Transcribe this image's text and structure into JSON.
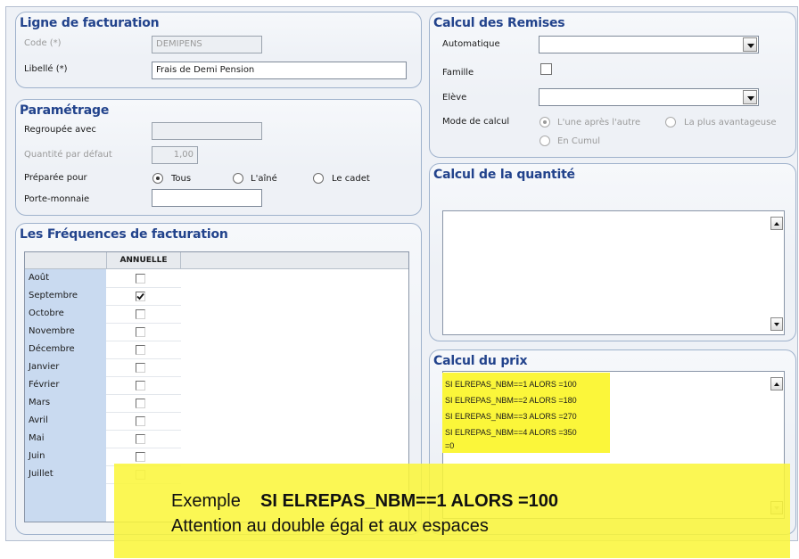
{
  "ligne": {
    "title": "Ligne de facturation",
    "code_label": "Code (*)",
    "code_value": "DEMIPENS",
    "libelle_label": "Libellé (*)",
    "libelle_value": "Frais de Demi Pension"
  },
  "parametrage": {
    "title": "Paramétrage",
    "regroupee_label": "Regroupée avec",
    "regroupee_value": "",
    "quantite_label": "Quantité par défaut",
    "quantite_value": "1,00",
    "preparee_label": "Préparée pour",
    "options": [
      "Tous",
      "L'aîné",
      "Le cadet"
    ],
    "selected_option": "Tous",
    "porte_label": "Porte-monnaie",
    "porte_value": ""
  },
  "frequences": {
    "title": "Les Fréquences de facturation",
    "column": "ANNUELLE",
    "months": [
      {
        "name": "Août",
        "checked": false
      },
      {
        "name": "Septembre",
        "checked": true
      },
      {
        "name": "Octobre",
        "checked": false
      },
      {
        "name": "Novembre",
        "checked": false
      },
      {
        "name": "Décembre",
        "checked": false
      },
      {
        "name": "Janvier",
        "checked": false
      },
      {
        "name": "Février",
        "checked": false
      },
      {
        "name": "Mars",
        "checked": false
      },
      {
        "name": "Avril",
        "checked": false
      },
      {
        "name": "Mai",
        "checked": false
      },
      {
        "name": "Juin",
        "checked": false
      },
      {
        "name": "Juillet",
        "checked": false
      }
    ]
  },
  "remises": {
    "title": "Calcul des Remises",
    "automatique_label": "Automatique",
    "automatique_value": "",
    "famille_label": "Famille",
    "eleve_label": "Elève",
    "eleve_value": "",
    "mode_label": "Mode de calcul",
    "modes": [
      "L'une après l'autre",
      "La plus avantageuse",
      "En Cumul"
    ],
    "selected_mode": "L'une après l'autre"
  },
  "quantite": {
    "title": "Calcul de la quantité",
    "text": ""
  },
  "prix": {
    "title": "Calcul du prix",
    "lines": [
      "SI ELREPAS_NBM==1 ALORS =100",
      "SI ELREPAS_NBM==2 ALORS =180",
      "SI ELREPAS_NBM==3 ALORS =270",
      "SI ELREPAS_NBM==4 ALORS =350",
      "=0"
    ]
  },
  "annotation": {
    "prefix": "Exemple",
    "formula": "SI ELREPAS_NBM==1 ALORS =100",
    "note": "Attention au double égal et aux espaces"
  },
  "colors": {
    "title_blue": "#22438c",
    "month_column": "#c9daf0",
    "highlight_yellow": "#fbf63a"
  }
}
